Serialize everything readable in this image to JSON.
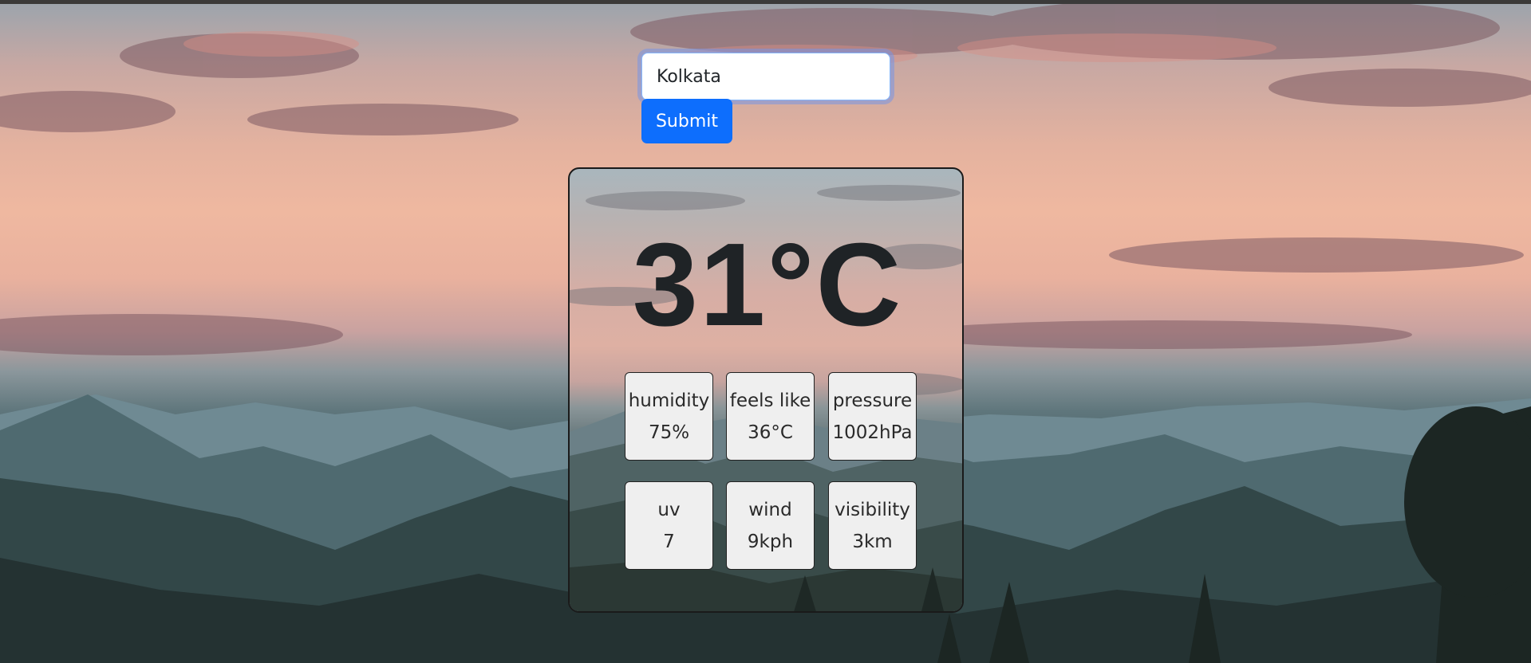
{
  "search": {
    "value": "Kolkata",
    "submit_label": "Submit"
  },
  "weather": {
    "temperature": "31°C",
    "stats": [
      {
        "label": "humidity",
        "value": "75%"
      },
      {
        "label": "feels like",
        "value": "36°C"
      },
      {
        "label": "pressure",
        "value": "1002hPa"
      },
      {
        "label": "uv",
        "value": "7"
      },
      {
        "label": "wind",
        "value": "9kph"
      },
      {
        "label": "visibility",
        "value": "3km"
      }
    ]
  },
  "colors": {
    "primary": "#0d6efd",
    "focus_ring": "#86b7fe",
    "tile_background": "#efefef",
    "temperature_text": "#1f2326"
  }
}
